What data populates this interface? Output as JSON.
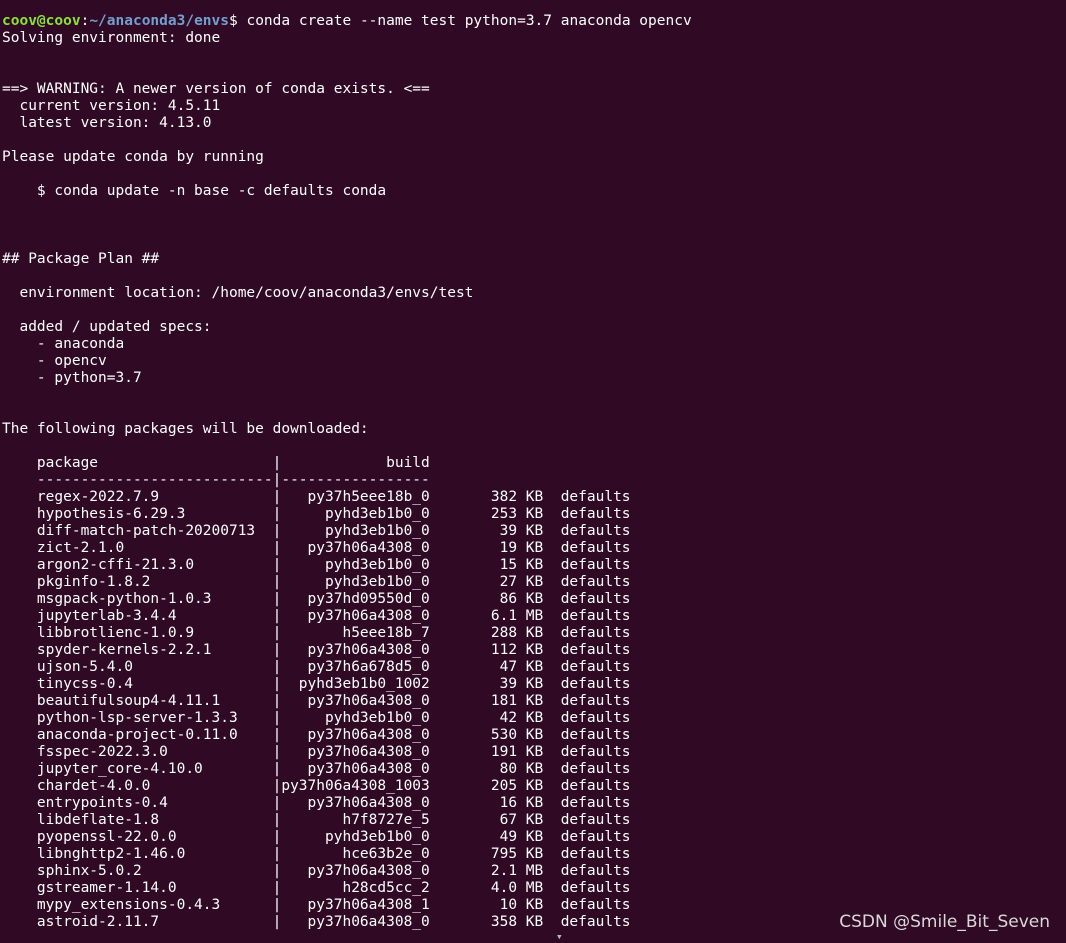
{
  "prompt": {
    "user_host": "coov@coov",
    "path": "~/anaconda3/envs",
    "symbol": "$",
    "command": " conda create --name test python=3.7 anaconda opencv"
  },
  "output_lines": [
    "Solving environment: done",
    "",
    "",
    "==> WARNING: A newer version of conda exists. <==",
    "  current version: 4.5.11",
    "  latest version: 4.13.0",
    "",
    "Please update conda by running",
    "",
    "    $ conda update -n base -c defaults conda",
    "",
    "",
    "",
    "## Package Plan ##",
    "",
    "  environment location: /home/coov/anaconda3/envs/test",
    "",
    "  added / updated specs:",
    "    - anaconda",
    "    - opencv",
    "    - python=3.7",
    "",
    "",
    "The following packages will be downloaded:",
    "",
    "    package                    |            build",
    "    ---------------------------|-----------------"
  ],
  "packages": [
    {
      "name": "regex-2022.7.9",
      "build": "py37h5eee18b_0",
      "size": "382 KB",
      "channel": "defaults"
    },
    {
      "name": "hypothesis-6.29.3",
      "build": "pyhd3eb1b0_0",
      "size": "253 KB",
      "channel": "defaults"
    },
    {
      "name": "diff-match-patch-20200713",
      "build": "pyhd3eb1b0_0",
      "size": "39 KB",
      "channel": "defaults"
    },
    {
      "name": "zict-2.1.0",
      "build": "py37h06a4308_0",
      "size": "19 KB",
      "channel": "defaults"
    },
    {
      "name": "argon2-cffi-21.3.0",
      "build": "pyhd3eb1b0_0",
      "size": "15 KB",
      "channel": "defaults"
    },
    {
      "name": "pkginfo-1.8.2",
      "build": "pyhd3eb1b0_0",
      "size": "27 KB",
      "channel": "defaults"
    },
    {
      "name": "msgpack-python-1.0.3",
      "build": "py37hd09550d_0",
      "size": "86 KB",
      "channel": "defaults"
    },
    {
      "name": "jupyterlab-3.4.4",
      "build": "py37h06a4308_0",
      "size": "6.1 MB",
      "channel": "defaults"
    },
    {
      "name": "libbrotlienc-1.0.9",
      "build": "h5eee18b_7",
      "size": "288 KB",
      "channel": "defaults"
    },
    {
      "name": "spyder-kernels-2.2.1",
      "build": "py37h06a4308_0",
      "size": "112 KB",
      "channel": "defaults"
    },
    {
      "name": "ujson-5.4.0",
      "build": "py37h6a678d5_0",
      "size": "47 KB",
      "channel": "defaults"
    },
    {
      "name": "tinycss-0.4",
      "build": "pyhd3eb1b0_1002",
      "size": "39 KB",
      "channel": "defaults"
    },
    {
      "name": "beautifulsoup4-4.11.1",
      "build": "py37h06a4308_0",
      "size": "181 KB",
      "channel": "defaults"
    },
    {
      "name": "python-lsp-server-1.3.3",
      "build": "pyhd3eb1b0_0",
      "size": "42 KB",
      "channel": "defaults"
    },
    {
      "name": "anaconda-project-0.11.0",
      "build": "py37h06a4308_0",
      "size": "530 KB",
      "channel": "defaults"
    },
    {
      "name": "fsspec-2022.3.0",
      "build": "py37h06a4308_0",
      "size": "191 KB",
      "channel": "defaults"
    },
    {
      "name": "jupyter_core-4.10.0",
      "build": "py37h06a4308_0",
      "size": "80 KB",
      "channel": "defaults"
    },
    {
      "name": "chardet-4.0.0",
      "build": "py37h06a4308_1003",
      "size": "205 KB",
      "channel": "defaults"
    },
    {
      "name": "entrypoints-0.4",
      "build": "py37h06a4308_0",
      "size": "16 KB",
      "channel": "defaults"
    },
    {
      "name": "libdeflate-1.8",
      "build": "h7f8727e_5",
      "size": "67 KB",
      "channel": "defaults"
    },
    {
      "name": "pyopenssl-22.0.0",
      "build": "pyhd3eb1b0_0",
      "size": "49 KB",
      "channel": "defaults"
    },
    {
      "name": "libnghttp2-1.46.0",
      "build": "hce63b2e_0",
      "size": "795 KB",
      "channel": "defaults"
    },
    {
      "name": "sphinx-5.0.2",
      "build": "py37h06a4308_0",
      "size": "2.1 MB",
      "channel": "defaults"
    },
    {
      "name": "gstreamer-1.14.0",
      "build": "h28cd5cc_2",
      "size": "4.0 MB",
      "channel": "defaults"
    },
    {
      "name": "mypy_extensions-0.4.3",
      "build": "py37h06a4308_1",
      "size": "10 KB",
      "channel": "defaults"
    },
    {
      "name": "astroid-2.11.7",
      "build": "py37h06a4308_0",
      "size": "358 KB",
      "channel": "defaults"
    }
  ],
  "watermark": "CSDN @Smile_Bit_Seven",
  "scroll_glyph": "▾",
  "colors": {
    "background": "#300a24",
    "text": "#ffffff",
    "prompt_user": "#8ae234",
    "prompt_path": "#729fcf"
  }
}
